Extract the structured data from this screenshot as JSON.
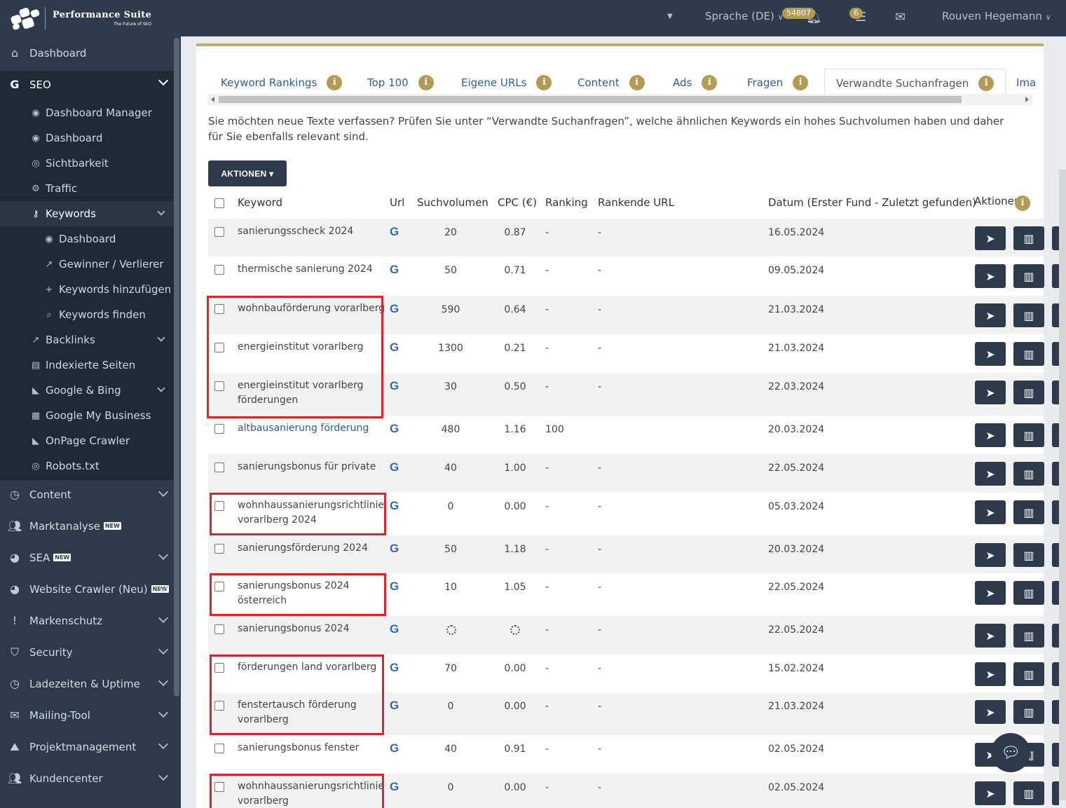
{
  "brand": {
    "name": "Performance Suite",
    "tagline": "The Future of SEO"
  },
  "topbar": {
    "language": "Sprache (DE)",
    "notification_count": "54807",
    "tasks_count": "6",
    "user": "Rouven Hegemann"
  },
  "sidebar": {
    "dashboard": "Dashboard",
    "seo": "SEO",
    "seo_items": {
      "dashboard_manager": "Dashboard Manager",
      "dashboard": "Dashboard",
      "sichtbarkeit": "Sichtbarkeit",
      "traffic": "Traffic",
      "keywords": "Keywords",
      "kw_dashboard": "Dashboard",
      "kw_gewinner": "Gewinner / Verlierer",
      "kw_hinzufuegen": "Keywords hinzufügen",
      "kw_finden": "Keywords finden",
      "backlinks": "Backlinks",
      "indexierte": "Indexierte Seiten",
      "google_bing": "Google & Bing",
      "gmb": "Google My Business",
      "onpage": "OnPage Crawler",
      "robots": "Robots.txt"
    },
    "content": "Content",
    "marktanalyse": "Marktanalyse",
    "sea": "SEA",
    "website_crawler": "Website Crawler (Neu)",
    "markenschutz": "Markenschutz",
    "security": "Security",
    "ladezeiten": "Ladezeiten & Uptime",
    "mailing": "Mailing-Tool",
    "projektmanagement": "Projektmanagement",
    "kundencenter": "Kundencenter",
    "new_badge": "NEW"
  },
  "tabs": [
    "Keyword Rankings",
    "Top 100",
    "Eigene URLs",
    "Content",
    "Ads",
    "Fragen",
    "Verwandte Suchanfragen",
    "Ima"
  ],
  "intro": "Sie möchten neue Texte verfassen? Prüfen Sie unter “Verwandte Suchanfragen”, welche ähnlichen Keywords ein hohes Suchvolumen haben und daher für Sie ebenfalls relevant sind.",
  "actions_button": "AKTIONEN",
  "table": {
    "headers": {
      "keyword": "Keyword",
      "url": "Url",
      "volume": "Suchvolumen",
      "cpc": "CPC (€)",
      "ranking": "Ranking",
      "ranking_url": "Rankende URL",
      "date": "Datum (Erster Fund - Zuletzt gefunden)",
      "actions": "Aktionen"
    },
    "rows": [
      {
        "keyword": "sanierungsscheck 2024",
        "volume": "20",
        "cpc": "0.87",
        "ranking": "-",
        "rurl": "-",
        "date": "16.05.2024"
      },
      {
        "keyword": "thermische sanierung 2024",
        "volume": "50",
        "cpc": "0.71",
        "ranking": "-",
        "rurl": "-",
        "date": "09.05.2024"
      },
      {
        "keyword": "wohnbauförderung vorarlberg",
        "volume": "590",
        "cpc": "0.64",
        "ranking": "-",
        "rurl": "-",
        "date": "21.03.2024"
      },
      {
        "keyword": "energieinstitut vorarlberg",
        "volume": "1300",
        "cpc": "0.21",
        "ranking": "-",
        "rurl": "-",
        "date": "21.03.2024"
      },
      {
        "keyword": "energieinstitut vorarlberg",
        "keyword2": "förderungen",
        "volume": "30",
        "cpc": "0.50",
        "ranking": "-",
        "rurl": "-",
        "date": "22.03.2024"
      },
      {
        "keyword": "altbausanierung förderung",
        "volume": "480",
        "cpc": "1.16",
        "ranking": "100",
        "rurl": "",
        "date": "20.03.2024"
      },
      {
        "keyword": "sanierungsbonus für private",
        "volume": "40",
        "cpc": "1.00",
        "ranking": "-",
        "rurl": "-",
        "date": "22.05.2024"
      },
      {
        "keyword": "wohnhaussanierungsrichtlinie",
        "keyword2": "vorarlberg 2024",
        "volume": "0",
        "cpc": "0.00",
        "ranking": "-",
        "rurl": "-",
        "date": "05.03.2024"
      },
      {
        "keyword": "sanierungsförderung 2024",
        "volume": "50",
        "cpc": "1.18",
        "ranking": "-",
        "rurl": "-",
        "date": "20.03.2024"
      },
      {
        "keyword": "sanierungsbonus 2024",
        "keyword2": "österreich",
        "volume": "10",
        "cpc": "1.05",
        "ranking": "-",
        "rurl": "-",
        "date": "22.05.2024"
      },
      {
        "keyword": "sanierungsbonus 2024",
        "volume": "",
        "cpc": "",
        "ranking": "-",
        "rurl": "-",
        "date": "22.05.2024"
      },
      {
        "keyword": "förderungen land vorarlberg",
        "volume": "70",
        "cpc": "0.00",
        "ranking": "-",
        "rurl": "-",
        "date": "15.02.2024"
      },
      {
        "keyword": "fenstertausch förderung",
        "keyword2": "vorarlberg",
        "volume": "0",
        "cpc": "0.00",
        "ranking": "-",
        "rurl": "-",
        "date": "21.03.2024"
      },
      {
        "keyword": "sanierungsbonus fenster",
        "volume": "40",
        "cpc": "0.91",
        "ranking": "-",
        "rurl": "-",
        "date": "02.05.2024"
      },
      {
        "keyword": "wohnhaussanierungsrichtlinie",
        "keyword2": "vorarlberg",
        "volume": "0",
        "cpc": "0.00",
        "ranking": "-",
        "rurl": "-",
        "date": "02.05.2024"
      }
    ]
  },
  "colors": {
    "accent": "#b59b52",
    "nav": "#2d3a4b",
    "link": "#2c5e9b",
    "highlight": "#d9242e"
  },
  "icons": {
    "url_col": "google-g-icon",
    "action1": "paper-plane-icon",
    "action2": "book-open-icon",
    "chat": "chat-bubble-icon"
  }
}
